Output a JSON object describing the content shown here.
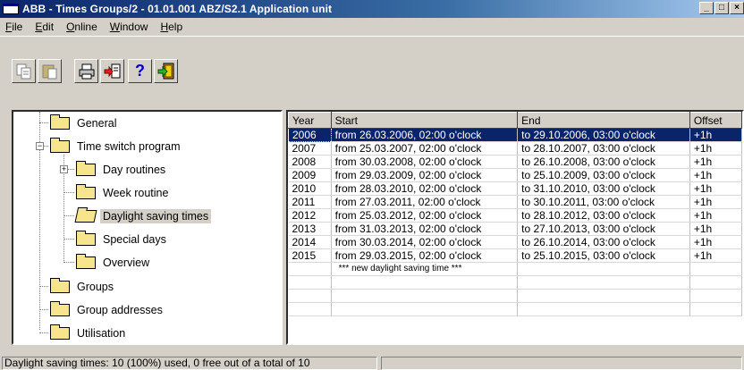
{
  "window": {
    "title": "ABB - Times Groups/2 - 01.01.001 ABZ/S2.1 Application unit",
    "minimize": "_",
    "restore": "□",
    "close": "×"
  },
  "menu": [
    {
      "label": "File",
      "underline": "F",
      "rest": "ile"
    },
    {
      "label": "Edit",
      "underline": "E",
      "rest": "dit"
    },
    {
      "label": "Online",
      "underline": "O",
      "rest": "nline"
    },
    {
      "label": "Window",
      "underline": "W",
      "rest": "indow"
    },
    {
      "label": "Help",
      "underline": "H",
      "rest": "elp"
    }
  ],
  "toolbar": {
    "buttons": [
      {
        "name": "copy-icon"
      },
      {
        "name": "paste-icon"
      },
      {
        "name": "print-icon"
      },
      {
        "name": "import-icon"
      },
      {
        "name": "help-icon",
        "glyph": "?"
      },
      {
        "name": "exit-icon"
      }
    ]
  },
  "tree": {
    "general": "General",
    "time_switch_program": "Time switch program",
    "day_routines": "Day routines",
    "week_routine": "Week routine",
    "daylight_saving_times": "Daylight saving times",
    "special_days": "Special days",
    "overview": "Overview",
    "groups": "Groups",
    "group_addresses": "Group addresses",
    "utilisation": "Utilisation"
  },
  "table": {
    "columns": [
      "Year",
      "Start",
      "End",
      "Offset"
    ],
    "rows": [
      [
        "2006",
        "from 26.03.2006, 02:00 o'clock",
        "to 29.10.2006, 03:00 o'clock",
        "+1h"
      ],
      [
        "2007",
        "from 25.03.2007, 02:00 o'clock",
        "to 28.10.2007, 03:00 o'clock",
        "+1h"
      ],
      [
        "2008",
        "from 30.03.2008, 02:00 o'clock",
        "to 26.10.2008, 03:00 o'clock",
        "+1h"
      ],
      [
        "2009",
        "from 29.03.2009, 02:00 o'clock",
        "to 25.10.2009, 03:00 o'clock",
        "+1h"
      ],
      [
        "2010",
        "from 28.03.2010, 02:00 o'clock",
        "to 31.10.2010, 03:00 o'clock",
        "+1h"
      ],
      [
        "2011",
        "from 27.03.2011, 02:00 o'clock",
        "to 30.10.2011, 03:00 o'clock",
        "+1h"
      ],
      [
        "2012",
        "from 25.03.2012, 02:00 o'clock",
        "to 28.10.2012, 03:00 o'clock",
        "+1h"
      ],
      [
        "2013",
        "from 31.03.2013, 02:00 o'clock",
        "to 27.10.2013, 03:00 o'clock",
        "+1h"
      ],
      [
        "2014",
        "from 30.03.2014, 02:00 o'clock",
        "to 26.10.2014, 03:00 o'clock",
        "+1h"
      ],
      [
        "2015",
        "from 29.03.2015, 02:00 o'clock",
        "to 25.10.2015, 03:00 o'clock",
        "+1h"
      ]
    ],
    "new_row_label": "*** new daylight saving time ***",
    "selected_row": 0
  },
  "status": {
    "text": "Daylight saving times: 10 (100%) used, 0 free out of a total of 10"
  },
  "colors": {
    "titlebar": "#0a246a",
    "selection": "#0a246a",
    "face": "#d4d0c8",
    "folder": "#f6e58c"
  }
}
